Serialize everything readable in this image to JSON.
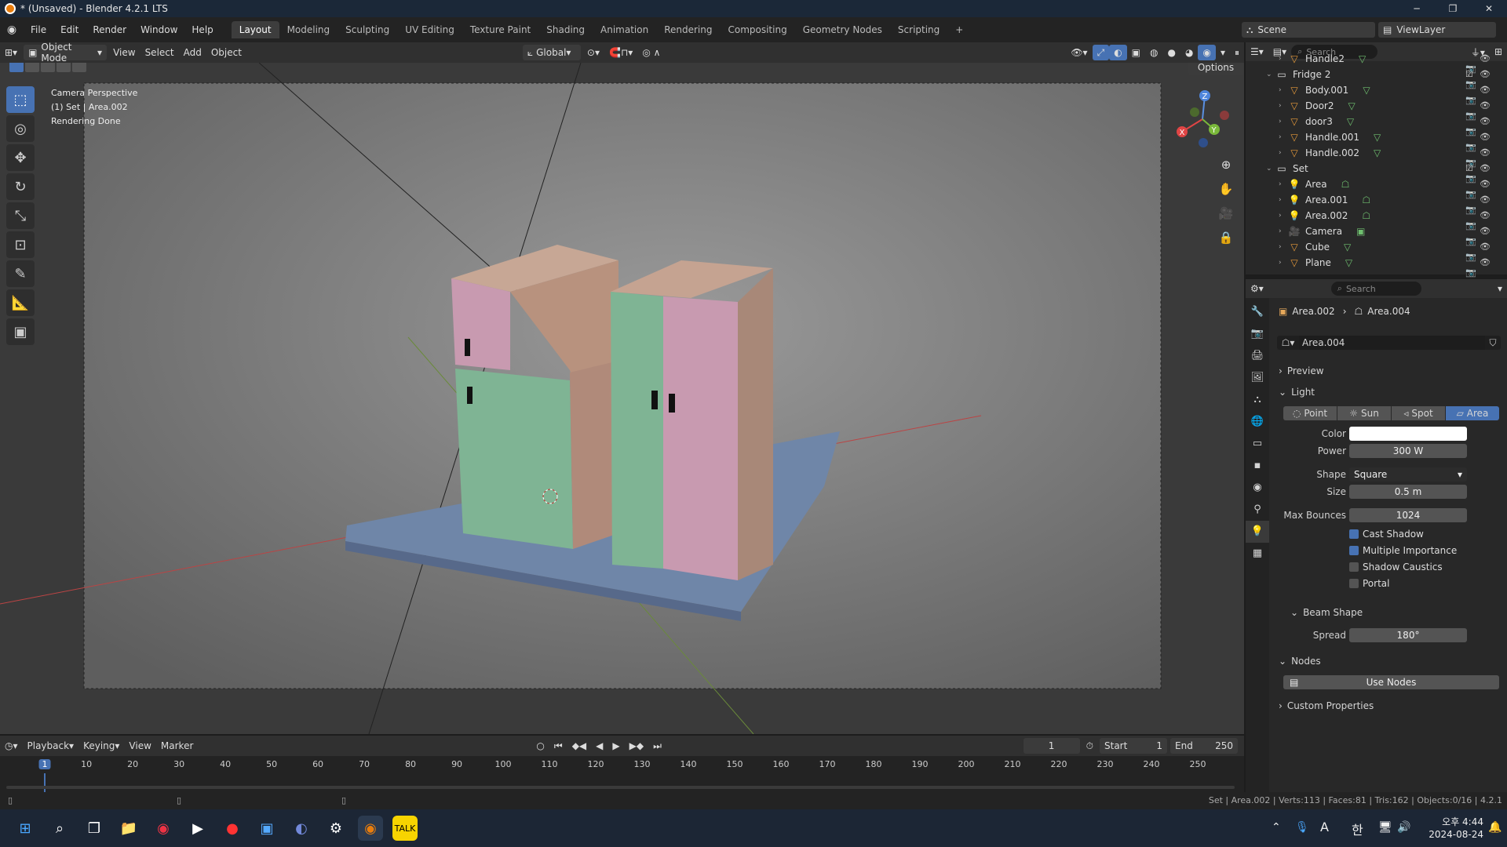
{
  "window": {
    "title": "* (Unsaved) - Blender 4.2.1 LTS"
  },
  "menu": [
    "File",
    "Edit",
    "Render",
    "Window",
    "Help"
  ],
  "workspaces": [
    "Layout",
    "Modeling",
    "Sculpting",
    "UV Editing",
    "Texture Paint",
    "Shading",
    "Animation",
    "Rendering",
    "Compositing",
    "Geometry Nodes",
    "Scripting"
  ],
  "scene": {
    "name": "Scene",
    "view_layer": "ViewLayer"
  },
  "viewport": {
    "mode": "Object Mode",
    "menus": [
      "View",
      "Select",
      "Add",
      "Object"
    ],
    "transform": "Global",
    "options": "Options",
    "overlay_lines": [
      "Camera Perspective",
      "(1) Set | Area.002",
      "Rendering Done"
    ]
  },
  "outliner": {
    "search_placeholder": "Search",
    "items": [
      {
        "name": "Handle2",
        "depth": 2,
        "type": "mesh"
      },
      {
        "name": "Fridge 2",
        "depth": 1,
        "type": "collection"
      },
      {
        "name": "Body.001",
        "depth": 2,
        "type": "mesh"
      },
      {
        "name": "Door2",
        "depth": 2,
        "type": "mesh"
      },
      {
        "name": "door3",
        "depth": 2,
        "type": "mesh"
      },
      {
        "name": "Handle.001",
        "depth": 2,
        "type": "mesh"
      },
      {
        "name": "Handle.002",
        "depth": 2,
        "type": "mesh"
      },
      {
        "name": "Set",
        "depth": 1,
        "type": "collection"
      },
      {
        "name": "Area",
        "depth": 2,
        "type": "light"
      },
      {
        "name": "Area.001",
        "depth": 2,
        "type": "light"
      },
      {
        "name": "Area.002",
        "depth": 2,
        "type": "light"
      },
      {
        "name": "Camera",
        "depth": 2,
        "type": "camera"
      },
      {
        "name": "Cube",
        "depth": 2,
        "type": "mesh"
      },
      {
        "name": "Plane",
        "depth": 2,
        "type": "mesh"
      }
    ]
  },
  "properties": {
    "search_placeholder": "Search",
    "breadcrumb_obj": "Area.002",
    "breadcrumb_data": "Area.004",
    "datablock": "Area.004",
    "preview": "Preview",
    "light": "Light",
    "light_types": [
      "Point",
      "Sun",
      "Spot",
      "Area"
    ],
    "color_label": "Color",
    "power_label": "Power",
    "power": "300 W",
    "shape_label": "Shape",
    "shape": "Square",
    "size_label": "Size",
    "size": "0.5 m",
    "bounces_label": "Max Bounces",
    "bounces": "1024",
    "checks": [
      {
        "label": "Cast Shadow",
        "on": true
      },
      {
        "label": "Multiple Importance",
        "on": true
      },
      {
        "label": "Shadow Caustics",
        "on": false
      },
      {
        "label": "Portal",
        "on": false
      }
    ],
    "beam_shape": "Beam Shape",
    "spread_label": "Spread",
    "spread": "180°",
    "nodes": "Nodes",
    "use_nodes": "Use Nodes",
    "custom_props": "Custom Properties"
  },
  "timeline": {
    "menus": [
      "Playback",
      "Keying",
      "View",
      "Marker"
    ],
    "current": "1",
    "start_label": "Start",
    "start": "1",
    "end_label": "End",
    "end": "250",
    "ticks": [
      "1",
      "10",
      "20",
      "30",
      "40",
      "50",
      "60",
      "70",
      "80",
      "90",
      "100",
      "110",
      "120",
      "130",
      "140",
      "150",
      "160",
      "170",
      "180",
      "190",
      "200",
      "210",
      "220",
      "230",
      "240",
      "250"
    ]
  },
  "status": {
    "text": "Set | Area.002 | Verts:113 | Faces:81 | Tris:162 | Objects:0/16 | 4.2.1"
  },
  "taskbar": {
    "time": "오후 4:44",
    "date": "2024-08-24",
    "ime": "A",
    "lang": "한"
  }
}
